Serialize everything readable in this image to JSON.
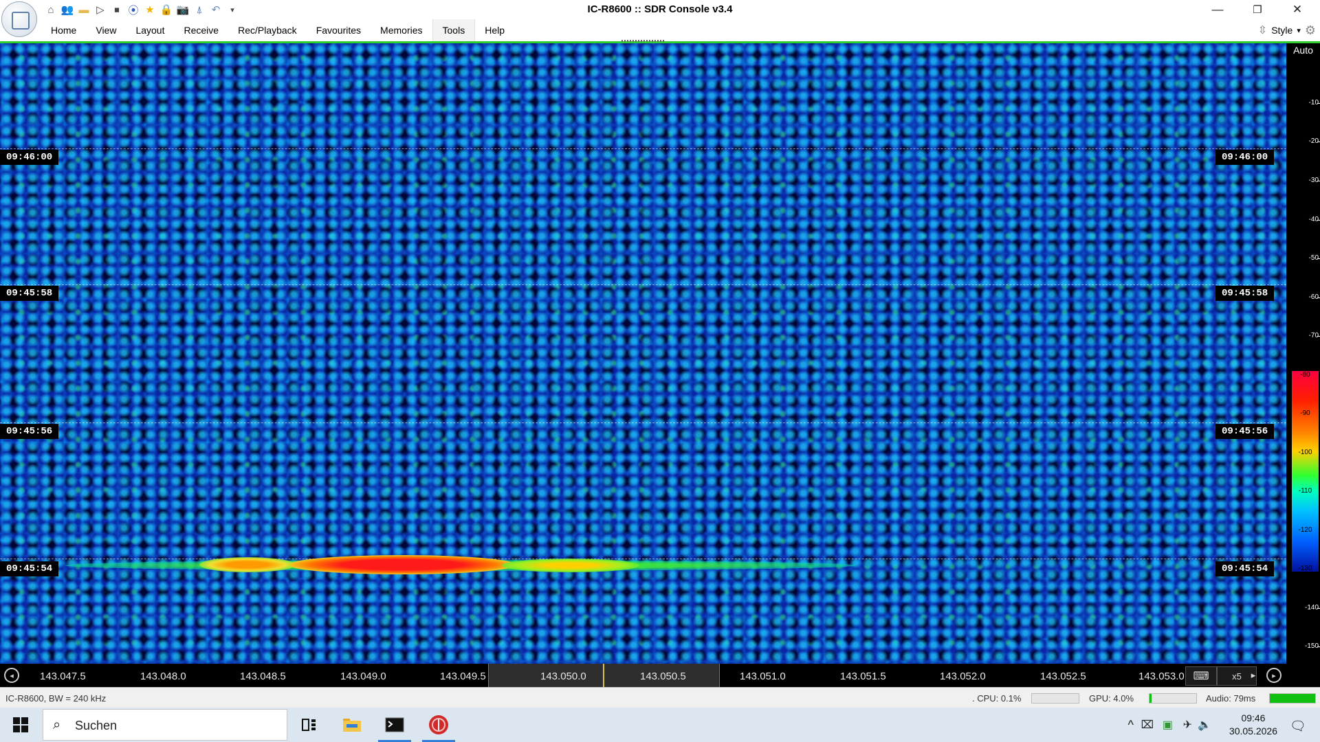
{
  "window": {
    "title": "IC-R8600 :: SDR Console v3.4",
    "controls": {
      "minimize": "—",
      "restore": "❐",
      "close": "✕"
    }
  },
  "quick_access": [
    {
      "name": "home-icon",
      "glyph": "⌂"
    },
    {
      "name": "users-icon",
      "glyph": "👥"
    },
    {
      "name": "folder-icon",
      "glyph": "▬"
    },
    {
      "name": "play-icon",
      "glyph": "▷"
    },
    {
      "name": "stop-icon",
      "glyph": "⏹"
    },
    {
      "name": "record-icon",
      "glyph": "⦿"
    },
    {
      "name": "star-icon",
      "glyph": "★"
    },
    {
      "name": "lock-icon",
      "glyph": "🔒"
    },
    {
      "name": "camera-icon",
      "glyph": "📷"
    },
    {
      "name": "satellite-icon",
      "glyph": "⍋"
    },
    {
      "name": "undo-icon",
      "glyph": "↶"
    },
    {
      "name": "customize-qat-icon",
      "glyph": "▾"
    }
  ],
  "menu": {
    "items": [
      "Home",
      "View",
      "Layout",
      "Receive",
      "Rec/Playback",
      "Favourites",
      "Memories",
      "Tools",
      "Help"
    ],
    "active": "Tools",
    "style_label": "Style",
    "style_arrow": "▾"
  },
  "waterfall": {
    "time_markers": [
      "09:46:00",
      "09:45:58",
      "09:45:56",
      "09:45:54"
    ]
  },
  "db_scale": {
    "mode": "Auto",
    "ticks": [
      "-10",
      "-20",
      "-30",
      "-40",
      "-50",
      "-60",
      "-70",
      "-80",
      "-90",
      "-100",
      "-110",
      "-120",
      "-130",
      "-140",
      "-150"
    ],
    "colorbar_range": [
      "-80",
      "-130"
    ]
  },
  "frequency_axis": {
    "labels": [
      "143.047.5",
      "143.048.0",
      "143.048.5",
      "143.049.0",
      "143.049.5",
      "143.050.0",
      "143.050.5",
      "143.051.0",
      "143.051.5",
      "143.052.0",
      "143.052.5",
      "143.053.0"
    ],
    "zoom": "x5",
    "zoom_arrow": "▸",
    "left_btn": "◂",
    "right_btn": "▸",
    "keyboard_icon": "⌨"
  },
  "status": {
    "device": "IC-R8600, BW = 240 kHz",
    "cpu": ". CPU: 0.1%",
    "cpu_level": 0.001,
    "gpu": "GPU: 4.0%",
    "gpu_level": 0.04,
    "audio": "Audio: 79ms",
    "audio_level": 1.0
  },
  "taskbar": {
    "search_placeholder": "Suchen",
    "time": "09:46",
    "date": "30.05.2026",
    "tray_chevron": "^",
    "notification_icon": "🗨"
  },
  "colors": {
    "accent_green": "#2fcf2f",
    "waterfall_base": "#0a55c8",
    "signal_hot": "#ff1a1a"
  }
}
